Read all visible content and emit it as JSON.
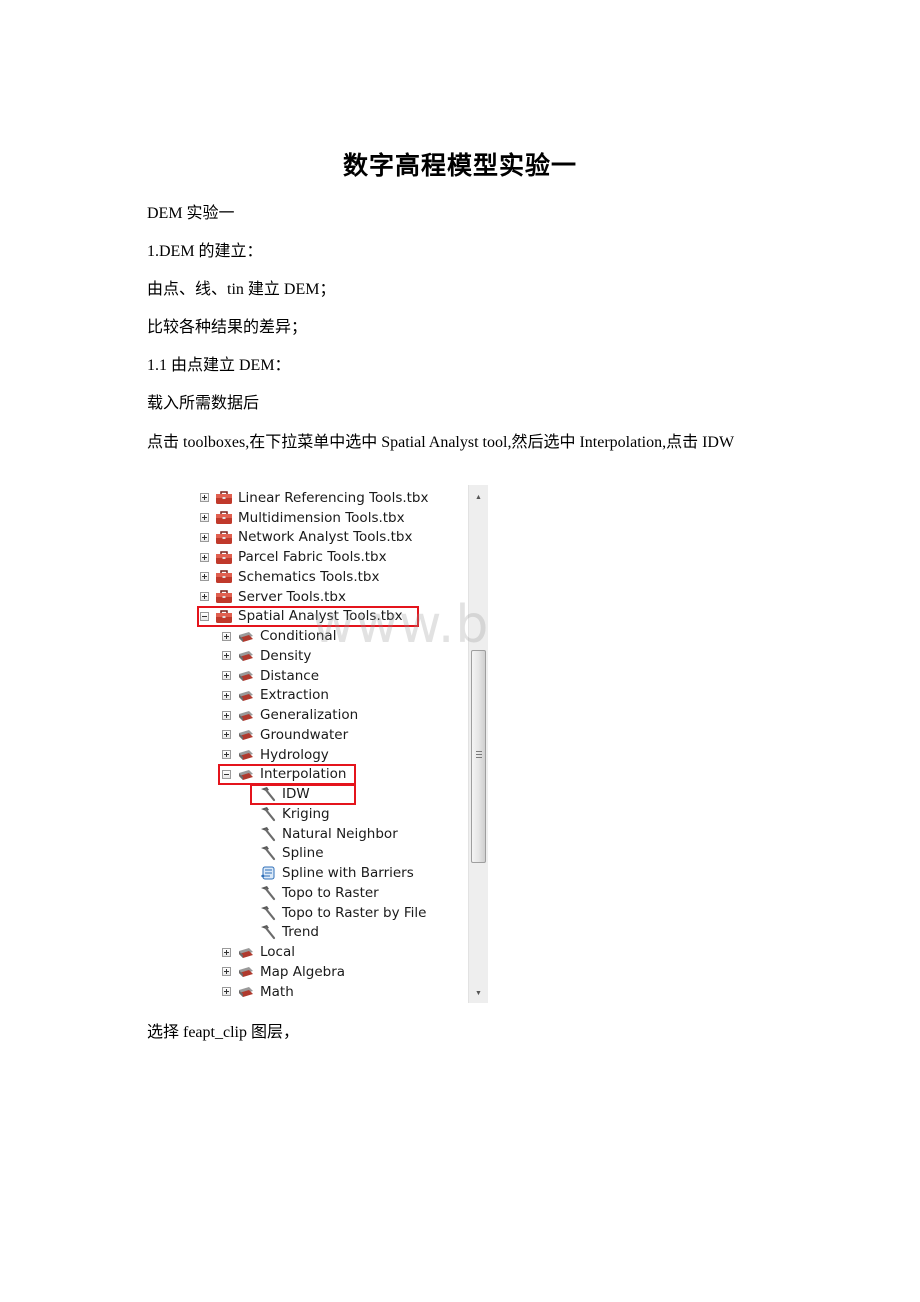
{
  "document": {
    "title": "数字高程模型实验一",
    "paragraphs": [
      "DEM 实验一",
      "1.DEM 的建立：",
      "由点、线、tin 建立 DEM；",
      "比较各种结果的差异；",
      "1.1 由点建立 DEM：",
      "载入所需数据后",
      "点击 toolboxes,在下拉菜单中选中 Spatial Analyst tool,然后选中 Interpolation,点击 IDW"
    ],
    "after_figure": "选择 feapt_clip 图层，",
    "watermark": "www.bdocx.com"
  },
  "screenshot": {
    "toolboxes": [
      {
        "label": "Linear Referencing Tools.tbx",
        "state": "collapsed"
      },
      {
        "label": "Multidimension Tools.tbx",
        "state": "collapsed"
      },
      {
        "label": "Network Analyst Tools.tbx",
        "state": "collapsed"
      },
      {
        "label": "Parcel Fabric Tools.tbx",
        "state": "collapsed"
      },
      {
        "label": "Schematics Tools.tbx",
        "state": "collapsed"
      },
      {
        "label": "Server Tools.tbx",
        "state": "collapsed"
      },
      {
        "label": "Spatial Analyst Tools.tbx",
        "state": "expanded",
        "highlighted": true
      }
    ],
    "toolsets": [
      {
        "label": "Conditional",
        "state": "collapsed"
      },
      {
        "label": "Density",
        "state": "collapsed"
      },
      {
        "label": "Distance",
        "state": "collapsed"
      },
      {
        "label": "Extraction",
        "state": "collapsed"
      },
      {
        "label": "Generalization",
        "state": "collapsed"
      },
      {
        "label": "Groundwater",
        "state": "collapsed"
      },
      {
        "label": "Hydrology",
        "state": "collapsed"
      },
      {
        "label": "Interpolation",
        "state": "expanded",
        "highlighted": true
      }
    ],
    "tools": [
      {
        "label": "IDW",
        "icon": "hammer-icon",
        "highlighted": true
      },
      {
        "label": "Kriging",
        "icon": "hammer-icon"
      },
      {
        "label": "Natural Neighbor",
        "icon": "hammer-icon"
      },
      {
        "label": "Spline",
        "icon": "hammer-icon"
      },
      {
        "label": "Spline with Barriers",
        "icon": "script-icon"
      },
      {
        "label": "Topo to Raster",
        "icon": "hammer-icon"
      },
      {
        "label": "Topo to Raster by File",
        "icon": "hammer-icon"
      },
      {
        "label": "Trend",
        "icon": "hammer-icon"
      }
    ],
    "toolsets_after": [
      {
        "label": "Local",
        "state": "collapsed"
      },
      {
        "label": "Map Algebra",
        "state": "collapsed"
      },
      {
        "label": "Math",
        "state": "collapsed"
      }
    ],
    "highlight_color": "#e4141c"
  }
}
